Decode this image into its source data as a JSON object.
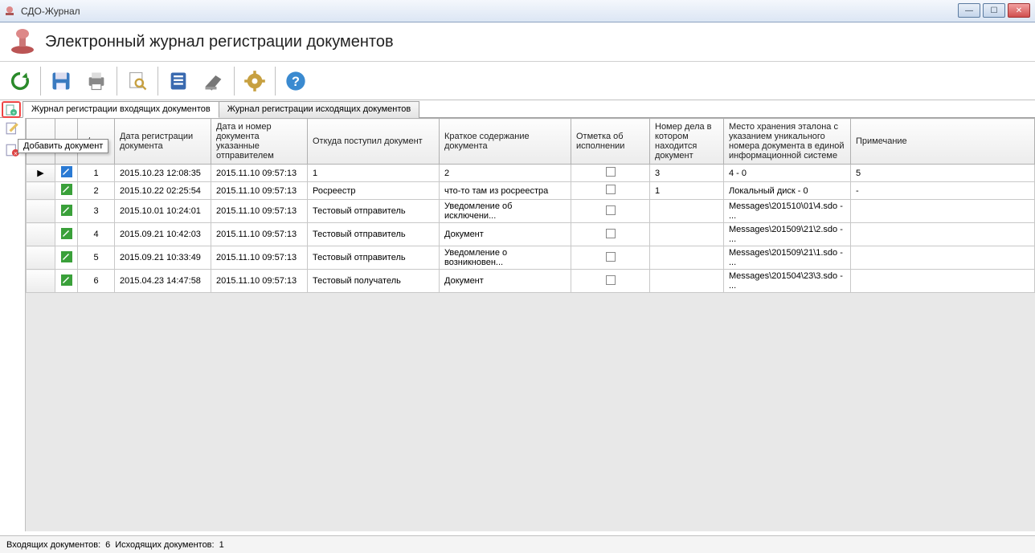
{
  "window": {
    "title": "СДО-Журнал"
  },
  "header": {
    "title": "Электронный журнал регистрации документов"
  },
  "toolbar": {
    "refresh": "Обновить",
    "save": "Сохранить",
    "print": "Печать",
    "find": "Поиск",
    "book": "Журнал",
    "scan": "Сканировать",
    "settings": "Настройки",
    "help": "Справка"
  },
  "tabs": {
    "incoming": "Журнал регистрации входящих документов",
    "outgoing": "Журнал регистрации исходящих документов"
  },
  "sidetools": {
    "add": "Добавить документ"
  },
  "tooltip": "Добавить документ",
  "columns": {
    "pp": "п/п",
    "reg_date": "Дата регистрации документа",
    "sender_date_no": "Дата и номер документа указанные отправителем",
    "from": "Откуда поступил документ",
    "summary": "Краткое содержание документа",
    "exec_mark": "Отметка об исполнении",
    "case_no": "Номер дела в котором находится документ",
    "storage": "Место хранения эталона с указанием уникального номера документа в единой информационной системе",
    "note": "Примечание"
  },
  "rows": [
    {
      "pp": "1",
      "reg": "2015.10.23 12:08:35",
      "send": "2015.11.10 09:57:13",
      "from": "1",
      "summary": "2",
      "exec": false,
      "case": "3",
      "store": "4 - 0",
      "note": "5",
      "current": true,
      "blue": true
    },
    {
      "pp": "2",
      "reg": "2015.10.22 02:25:54",
      "send": "2015.11.10 09:57:13",
      "from": "Росреестр",
      "summary": "что-то там из росреестра",
      "exec": false,
      "case": "1",
      "store": "Локальный диск - 0",
      "note": "-",
      "current": false,
      "blue": false
    },
    {
      "pp": "3",
      "reg": "2015.10.01 10:24:01",
      "send": "2015.11.10 09:57:13",
      "from": "Тестовый отправитель",
      "summary": "Уведомление об исключени...",
      "exec": false,
      "case": "",
      "store": "Messages\\201510\\01\\4.sdo - ...",
      "note": "",
      "current": false,
      "blue": false
    },
    {
      "pp": "4",
      "reg": "2015.09.21 10:42:03",
      "send": "2015.11.10 09:57:13",
      "from": "Тестовый отправитель",
      "summary": "Документ",
      "exec": false,
      "case": "",
      "store": "Messages\\201509\\21\\2.sdo - ...",
      "note": "",
      "current": false,
      "blue": false
    },
    {
      "pp": "5",
      "reg": "2015.09.21 10:33:49",
      "send": "2015.11.10 09:57:13",
      "from": "Тестовый отправитель",
      "summary": "Уведомление о возникновен...",
      "exec": false,
      "case": "",
      "store": "Messages\\201509\\21\\1.sdo - ...",
      "note": "",
      "current": false,
      "blue": false
    },
    {
      "pp": "6",
      "reg": "2015.04.23 14:47:58",
      "send": "2015.11.10 09:57:13",
      "from": "Тестовый получатель",
      "summary": "Документ",
      "exec": false,
      "case": "",
      "store": "Messages\\201504\\23\\3.sdo - ...",
      "note": "",
      "current": false,
      "blue": false
    }
  ],
  "status": {
    "incoming_label": "Входящих документов:",
    "incoming_count": "6",
    "outgoing_label": "Исходящих документов:",
    "outgoing_count": "1"
  }
}
